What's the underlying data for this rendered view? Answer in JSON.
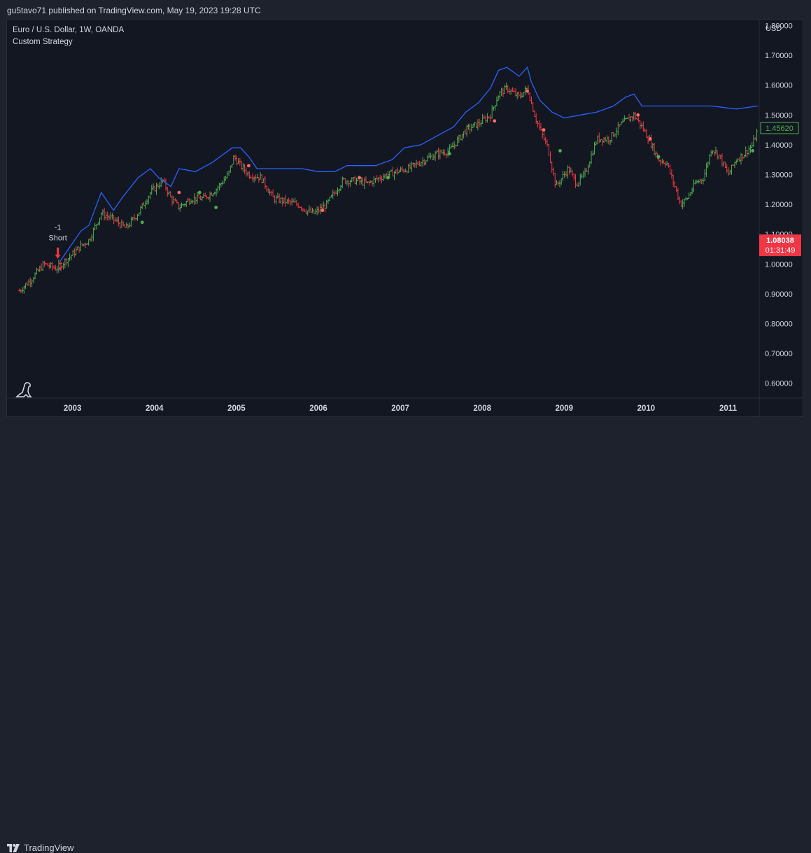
{
  "header": {
    "publish_text": "gu5tavo71 published on TradingView.com, May 19, 2023 19:28 UTC"
  },
  "legend": {
    "symbol": "Euro / U.S. Dollar, 1W, OANDA",
    "indicator": "Custom Strategy"
  },
  "footer": {
    "brand": "TradingView"
  },
  "colors": {
    "up": "#4caf50",
    "down": "#f23645",
    "band": "#2962ff",
    "background": "#131722",
    "frame": "#1e222d",
    "grid": "#2a2e39",
    "text": "#d1d4dc"
  },
  "chart_data": {
    "type": "line",
    "symbol": "EURUSD",
    "timeframe": "1W",
    "y_axis": {
      "unit": "USD",
      "ticks": [
        0.6,
        0.7,
        0.8,
        0.9,
        1.0,
        1.1,
        1.2,
        1.3,
        1.4,
        1.5,
        1.6,
        1.7,
        1.8
      ],
      "tick_labels": [
        "0.60000",
        "0.70000",
        "0.80000",
        "0.90000",
        "1.00000",
        "1.10000",
        "1.20000",
        "1.30000",
        "1.40000",
        "1.50000",
        "1.60000",
        "1.70000",
        "1.80000"
      ],
      "range": [
        0.55,
        1.82
      ]
    },
    "x_axis": {
      "labels": [
        "2003",
        "2004",
        "2005",
        "2006",
        "2007",
        "2008",
        "2009",
        "2010",
        "2011"
      ],
      "label_years": [
        2003,
        2004,
        2005,
        2006,
        2007,
        2008,
        2009,
        2010,
        2011
      ],
      "range": [
        2002.2,
        2011.38
      ]
    },
    "price_series": {
      "name": "EURUSD",
      "x": [
        2002.35,
        2002.5,
        2002.65,
        2002.8,
        2002.95,
        2003.1,
        2003.2,
        2003.35,
        2003.5,
        2003.65,
        2003.8,
        2003.95,
        2004.1,
        2004.2,
        2004.3,
        2004.45,
        2004.6,
        2004.75,
        2004.9,
        2004.97,
        2005.05,
        2005.15,
        2005.3,
        2005.45,
        2005.6,
        2005.75,
        2005.85,
        2005.95,
        2006.1,
        2006.3,
        2006.45,
        2006.6,
        2006.75,
        2006.95,
        2007.1,
        2007.3,
        2007.45,
        2007.6,
        2007.8,
        2007.95,
        2008.1,
        2008.2,
        2008.3,
        2008.45,
        2008.55,
        2008.65,
        2008.72,
        2008.8,
        2008.9,
        2008.95,
        2009.05,
        2009.15,
        2009.25,
        2009.4,
        2009.55,
        2009.7,
        2009.85,
        2009.95,
        2010.05,
        2010.15,
        2010.25,
        2010.35,
        2010.42,
        2010.5,
        2010.6,
        2010.7,
        2010.8,
        2010.9,
        2011.0,
        2011.1,
        2011.2,
        2011.3,
        2011.36
      ],
      "y": [
        0.91,
        0.95,
        1.0,
        0.985,
        1.02,
        1.06,
        1.08,
        1.17,
        1.15,
        1.12,
        1.17,
        1.24,
        1.28,
        1.22,
        1.19,
        1.22,
        1.22,
        1.25,
        1.3,
        1.36,
        1.33,
        1.3,
        1.29,
        1.22,
        1.21,
        1.2,
        1.18,
        1.17,
        1.2,
        1.28,
        1.28,
        1.27,
        1.29,
        1.31,
        1.32,
        1.35,
        1.37,
        1.38,
        1.45,
        1.47,
        1.5,
        1.57,
        1.59,
        1.56,
        1.59,
        1.49,
        1.44,
        1.39,
        1.26,
        1.28,
        1.32,
        1.27,
        1.3,
        1.42,
        1.42,
        1.47,
        1.5,
        1.46,
        1.41,
        1.35,
        1.34,
        1.26,
        1.2,
        1.22,
        1.27,
        1.29,
        1.39,
        1.36,
        1.3,
        1.35,
        1.37,
        1.4,
        1.45
      ]
    },
    "upper_band": {
      "color": "#2962ff",
      "x": [
        2002.85,
        2002.95,
        2003.1,
        2003.2,
        2003.35,
        2003.5,
        2003.6,
        2003.8,
        2003.95,
        2004.05,
        2004.2,
        2004.3,
        2004.5,
        2004.7,
        2004.85,
        2004.95,
        2005.05,
        2005.15,
        2005.25,
        2005.4,
        2005.6,
        2005.8,
        2006.0,
        2006.2,
        2006.35,
        2006.5,
        2006.7,
        2006.9,
        2007.05,
        2007.25,
        2007.45,
        2007.65,
        2007.8,
        2007.95,
        2008.1,
        2008.2,
        2008.3,
        2008.45,
        2008.55,
        2008.6,
        2008.7,
        2008.85,
        2009.0,
        2009.2,
        2009.4,
        2009.6,
        2009.75,
        2009.85,
        2009.95,
        2010.2,
        2010.5,
        2010.8,
        2011.1,
        2011.36
      ],
      "y": [
        1.01,
        1.05,
        1.11,
        1.13,
        1.24,
        1.18,
        1.22,
        1.29,
        1.32,
        1.29,
        1.26,
        1.32,
        1.31,
        1.34,
        1.37,
        1.39,
        1.39,
        1.36,
        1.32,
        1.32,
        1.32,
        1.32,
        1.31,
        1.31,
        1.33,
        1.33,
        1.33,
        1.35,
        1.39,
        1.4,
        1.43,
        1.46,
        1.51,
        1.54,
        1.59,
        1.65,
        1.66,
        1.63,
        1.66,
        1.61,
        1.55,
        1.51,
        1.49,
        1.5,
        1.51,
        1.53,
        1.56,
        1.57,
        1.53,
        1.53,
        1.53,
        1.53,
        1.52,
        1.53
      ]
    },
    "last_price": {
      "value": 1.4562,
      "label": "1.45620"
    },
    "current_price": {
      "value": 1.08038,
      "label": "1.08038",
      "countdown": "01:31:49"
    },
    "signals": [
      {
        "type": "short",
        "x": 2002.82,
        "y": 0.985,
        "qty_label": "-1",
        "text": "Short"
      }
    ],
    "dot_markers": {
      "up": [
        [
          2003.85,
          1.14
        ],
        [
          2004.55,
          1.24
        ],
        [
          2004.75,
          1.19
        ],
        [
          2006.85,
          1.29
        ],
        [
          2007.6,
          1.37
        ],
        [
          2008.95,
          1.38
        ],
        [
          2010.15,
          1.36
        ],
        [
          2011.3,
          1.38
        ]
      ],
      "down": [
        [
          2004.3,
          1.24
        ],
        [
          2005.15,
          1.33
        ],
        [
          2006.05,
          1.18
        ],
        [
          2006.5,
          1.29
        ],
        [
          2008.15,
          1.48
        ],
        [
          2008.55,
          1.58
        ],
        [
          2008.75,
          1.45
        ],
        [
          2009.9,
          1.5
        ],
        [
          2010.05,
          1.42
        ]
      ]
    }
  }
}
